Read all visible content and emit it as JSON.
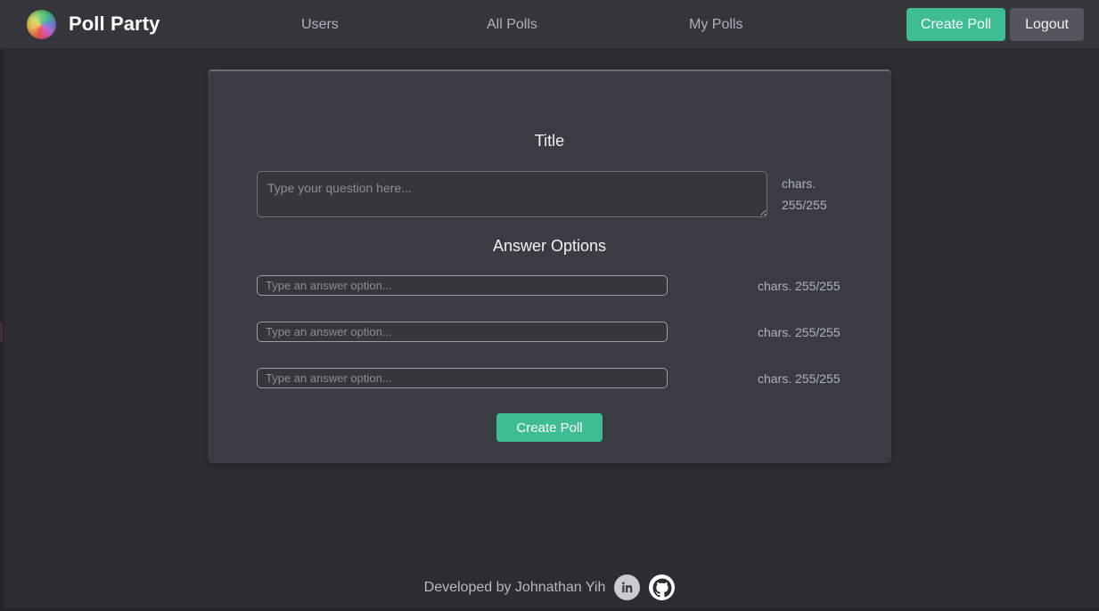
{
  "navbar": {
    "brand_title": "Poll Party",
    "brand_logo_icon": "color-wheel-sphere-icon",
    "links": [
      {
        "label": "Users",
        "name": "nav-link-users"
      },
      {
        "label": "All Polls",
        "name": "nav-link-all-polls"
      },
      {
        "label": "My Polls",
        "name": "nav-link-my-polls"
      }
    ],
    "create_poll_label": "Create Poll",
    "logout_label": "Logout",
    "create_poll_color": "#3dbd91",
    "logout_color": "#53565c",
    "background_color": "#34363b"
  },
  "card": {
    "title_heading": "Title",
    "answers_heading": "Answer Options",
    "title_field": {
      "value": "",
      "placeholder": "Type your question here...",
      "chars_label": "chars.",
      "chars_count": "255/255"
    },
    "answer_options": [
      {
        "value": "",
        "placeholder": "Type an answer option...",
        "chars": "chars. 255/255"
      },
      {
        "value": "",
        "placeholder": "Type an answer option...",
        "chars": "chars. 255/255"
      },
      {
        "value": "",
        "placeholder": "Type an answer option...",
        "chars": "chars. 255/255"
      }
    ],
    "submit_label": "Create Poll",
    "background_color": "#3a3c43"
  },
  "footer": {
    "credit_text": "Developed by Johnathan Yih",
    "social": [
      {
        "name": "linkedin-icon",
        "label": "in"
      },
      {
        "name": "github-icon",
        "label": "GitHub"
      }
    ]
  },
  "page": {
    "background_color": "#2b2d31"
  }
}
